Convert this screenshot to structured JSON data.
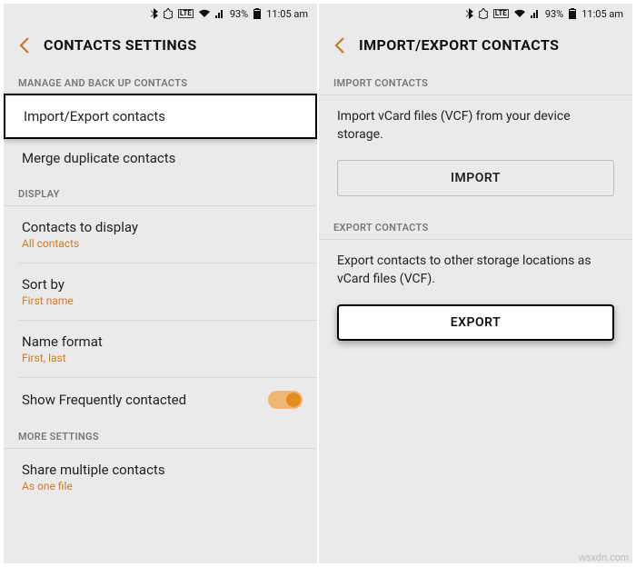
{
  "status": {
    "battery_pct": "93%",
    "time": "11:05 am"
  },
  "left": {
    "title": "CONTACTS SETTINGS",
    "sections": {
      "manage": "MANAGE AND BACK UP CONTACTS",
      "display": "DISPLAY",
      "more": "MORE SETTINGS"
    },
    "rows": {
      "import_export": "Import/Export contacts",
      "merge": "Merge duplicate contacts",
      "contacts_display": {
        "label": "Contacts to display",
        "value": "All contacts"
      },
      "sort_by": {
        "label": "Sort by",
        "value": "First name"
      },
      "name_format": {
        "label": "Name format",
        "value": "First, last"
      },
      "show_freq": "Show Frequently contacted",
      "share_multi": {
        "label": "Share multiple contacts",
        "value": "As one file"
      }
    }
  },
  "right": {
    "title": "IMPORT/EXPORT CONTACTS",
    "sections": {
      "import": "IMPORT CONTACTS",
      "export": "EXPORT CONTACTS"
    },
    "import_desc": "Import vCard files (VCF) from your device storage.",
    "export_desc": "Export contacts to other storage locations as vCard files (VCF).",
    "buttons": {
      "import": "IMPORT",
      "export": "EXPORT"
    }
  },
  "watermark": "wsxdn.com"
}
